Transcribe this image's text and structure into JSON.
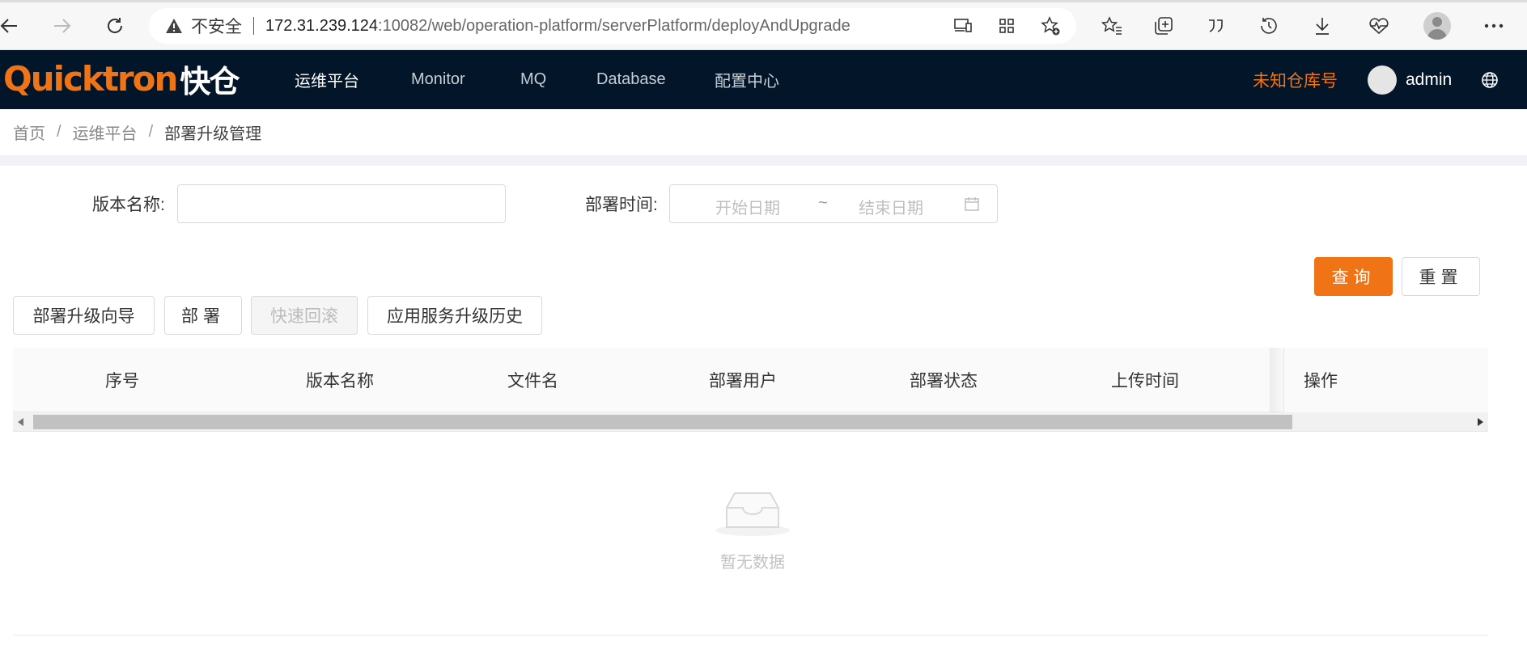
{
  "browser": {
    "security_label": "不安全",
    "url_host": "172.31.239.124",
    "url_rest": ":10082/web/operation-platform/serverPlatform/deployAndUpgrade"
  },
  "header": {
    "logo_text": "Quicktron",
    "logo_cn": "快仓",
    "nav": [
      "运维平台",
      "Monitor",
      "MQ",
      "Database",
      "配置中心"
    ],
    "warehouse": "未知仓库号",
    "user": "admin",
    "brand_color": "#f07316"
  },
  "breadcrumb": [
    "首页",
    "运维平台",
    "部署升级管理"
  ],
  "filters": {
    "version_label": "版本名称:",
    "version_value": "",
    "time_label": "部署时间:",
    "start_placeholder": "开始日期",
    "end_placeholder": "结束日期",
    "range_sep": "~"
  },
  "actions": {
    "query": "查询",
    "reset": "重置",
    "wizard": "部署升级向导",
    "deploy": "部署",
    "rollback": "快速回滚",
    "history": "应用服务升级历史"
  },
  "table": {
    "columns": [
      "序号",
      "版本名称",
      "文件名",
      "部署用户",
      "部署状态",
      "上传时间",
      "操作"
    ],
    "rows": [],
    "empty_text": "暂无数据"
  }
}
